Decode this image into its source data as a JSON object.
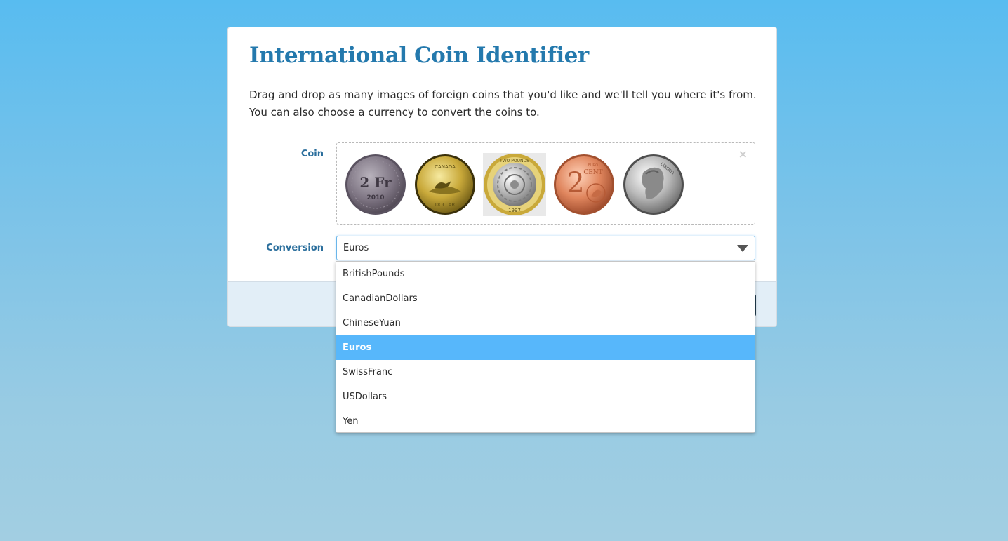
{
  "page": {
    "title": "International Coin Identifier",
    "description": "Drag and drop as many images of foreign coins that you'd like and we'll tell you where it's from. You can also choose a currency to convert the coins to."
  },
  "coin_field": {
    "label": "Coin",
    "clear_icon": "×",
    "coins": [
      {
        "name": "swiss-2-franc-coin",
        "text": "2 Fr",
        "year": "2010"
      },
      {
        "name": "canadian-loonie-coin",
        "text": "CANADA",
        "bottom": "DOLLAR"
      },
      {
        "name": "british-two-pound-coin",
        "text": "TWO POUNDS",
        "year": "1997"
      },
      {
        "name": "euro-2-cent-coin",
        "text": "2",
        "unit": "CENT",
        "top": "EURO"
      },
      {
        "name": "us-nickel-coin",
        "text": "LIBERTY"
      }
    ]
  },
  "conversion_field": {
    "label": "Conversion",
    "selected": "Euros",
    "options": [
      "BritishPounds",
      "CanadianDollars",
      "ChineseYuan",
      "Euros",
      "SwissFranc",
      "USDollars",
      "Yen"
    ],
    "selected_index": 3
  },
  "colors": {
    "title": "#2479ad",
    "label": "#2a6e9c",
    "highlight": "#57b7fb",
    "background_top": "#58bcf0",
    "background_bottom": "#a2cee2"
  }
}
